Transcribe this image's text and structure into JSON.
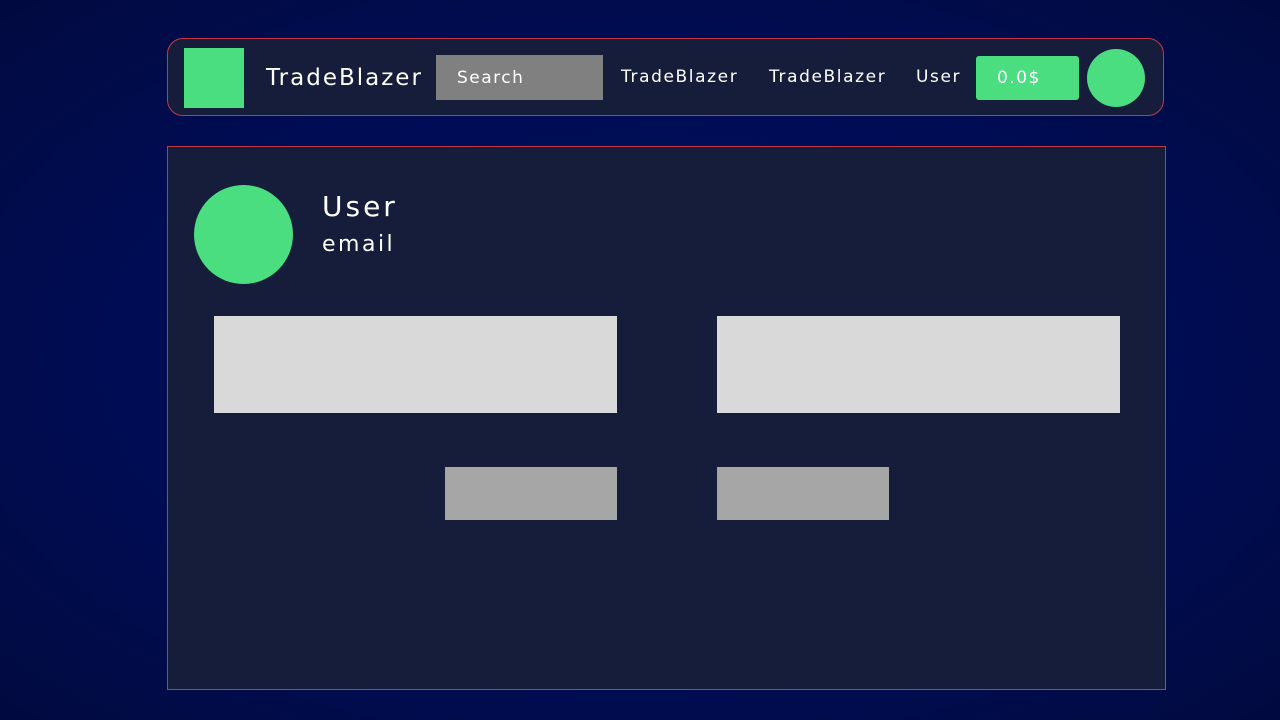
{
  "header": {
    "brand": "TradeBlazer",
    "search_placeholder": "Search",
    "links": [
      "TradeBlazer",
      "TradeBlazer",
      "User"
    ],
    "balance": "0.0$"
  },
  "profile": {
    "name": "User",
    "email": "email",
    "fields": [
      "",
      ""
    ],
    "actions": [
      "",
      ""
    ]
  },
  "colors": {
    "accent": "#4ade80",
    "panel": "#151d3b",
    "border": "#c03a46",
    "background": "#000d55"
  },
  "icons": {
    "logo": "logo-square",
    "user_avatar": "avatar-circle"
  }
}
